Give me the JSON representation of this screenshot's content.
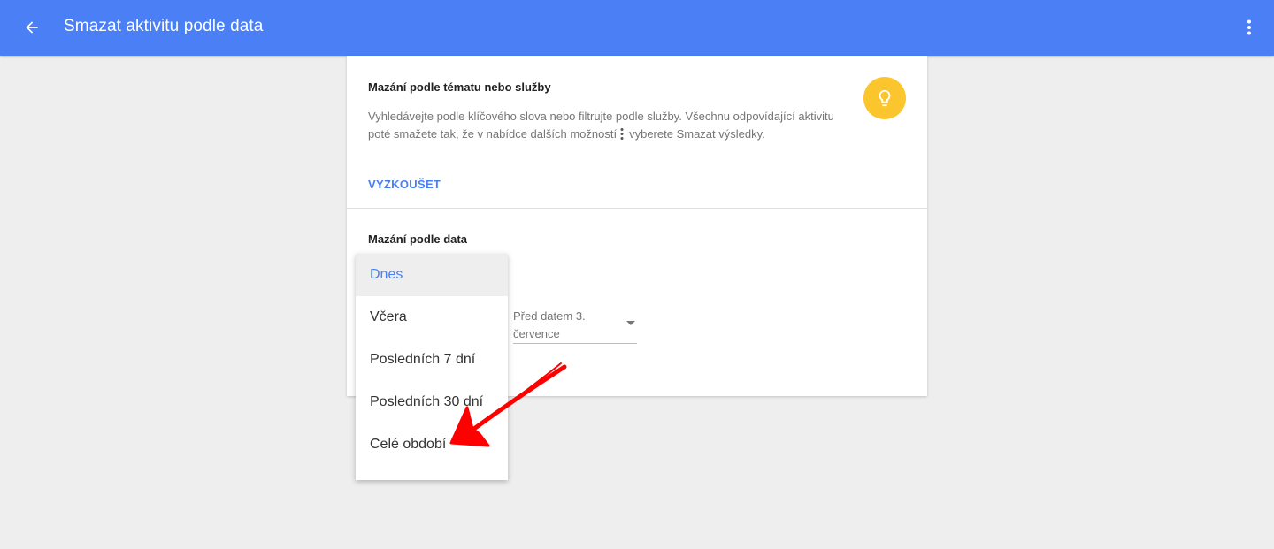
{
  "appbar": {
    "title": "Smazat aktivitu podle data",
    "back_icon": "arrow-back-icon",
    "more_icon": "more-vert-icon"
  },
  "topic_section": {
    "title": "Mazání podle tématu nebo služby",
    "desc_part1": "Vyhledávejte podle klíčového slova nebo filtrujte podle služby. Všechnu odpovídající aktivitu poté smažete tak, že v nabídce dalších možností",
    "desc_part2": "vyberete Smazat výsledky.",
    "try_label": "VYZKOUŠET",
    "icon": "lightbulb-icon"
  },
  "date_section": {
    "title": "Mazání podle data",
    "before_date": "Před datem 3. července",
    "menu": {
      "selected": "Dnes",
      "items": [
        "Dnes",
        "Včera",
        "Posledních 7 dní",
        "Posledních 30 dní",
        "Celé období"
      ]
    }
  },
  "colors": {
    "accent": "#4a7ff5",
    "bulb": "#fbc52d",
    "annotation": "#ff0000"
  }
}
